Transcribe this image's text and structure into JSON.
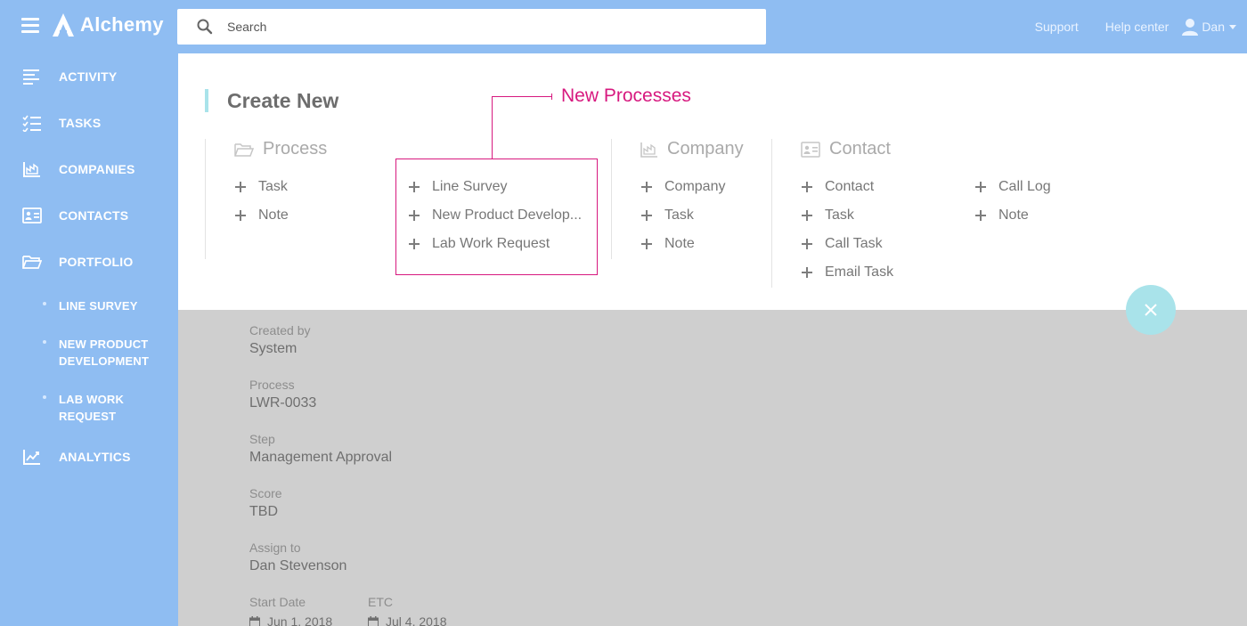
{
  "header": {
    "brand": "Alchemy",
    "search_placeholder": "Search",
    "links": [
      "Support",
      "Help center"
    ],
    "user_name": "Dan"
  },
  "sidebar": {
    "items": [
      {
        "label": "ACTIVITY",
        "icon": "activity-icon"
      },
      {
        "label": "TASKS",
        "icon": "tasks-icon"
      },
      {
        "label": "COMPANIES",
        "icon": "companies-icon"
      },
      {
        "label": "CONTACTS",
        "icon": "contacts-icon"
      },
      {
        "label": "PORTFOLIO",
        "icon": "folder-icon"
      },
      {
        "label": "ANALYTICS",
        "icon": "analytics-icon"
      }
    ],
    "portfolio_children": [
      {
        "line1": "LINE SURVEY",
        "line2": ""
      },
      {
        "line1": "NEW PRODUCT",
        "line2": "DEVELOPMENT"
      },
      {
        "line1": "LAB WORK",
        "line2": "REQUEST"
      }
    ]
  },
  "create_new": {
    "title": "Create New",
    "process": {
      "heading": "Process",
      "options": [
        "Task",
        "Note"
      ],
      "new_processes": [
        "Line Survey",
        "New Product Develop...",
        "Lab Work Request"
      ]
    },
    "company": {
      "heading": "Company",
      "options": [
        "Company",
        "Task",
        "Note"
      ]
    },
    "contact": {
      "heading": "Contact",
      "options_left": [
        "Contact",
        "Task",
        "Call Task",
        "Email Task"
      ],
      "options_right": [
        "Call Log",
        "Note"
      ]
    },
    "callout": "New Processes"
  },
  "details": {
    "created_by": {
      "label": "Created by",
      "value": "System"
    },
    "process": {
      "label": "Process",
      "value": "LWR-0033"
    },
    "step": {
      "label": "Step",
      "value": "Management Approval"
    },
    "score": {
      "label": "Score",
      "value": "TBD"
    },
    "assign_to": {
      "label": "Assign to",
      "value": "Dan Stevenson"
    },
    "start_date": {
      "label": "Start Date",
      "value": "Jun 1, 2018"
    },
    "etc": {
      "label": "ETC",
      "value": "Jul 4, 2018"
    }
  },
  "colors": {
    "sidebar_blue": "#8fbdf2",
    "accent_teal": "#a9e3ea",
    "callout_magenta": "#d7197f"
  }
}
